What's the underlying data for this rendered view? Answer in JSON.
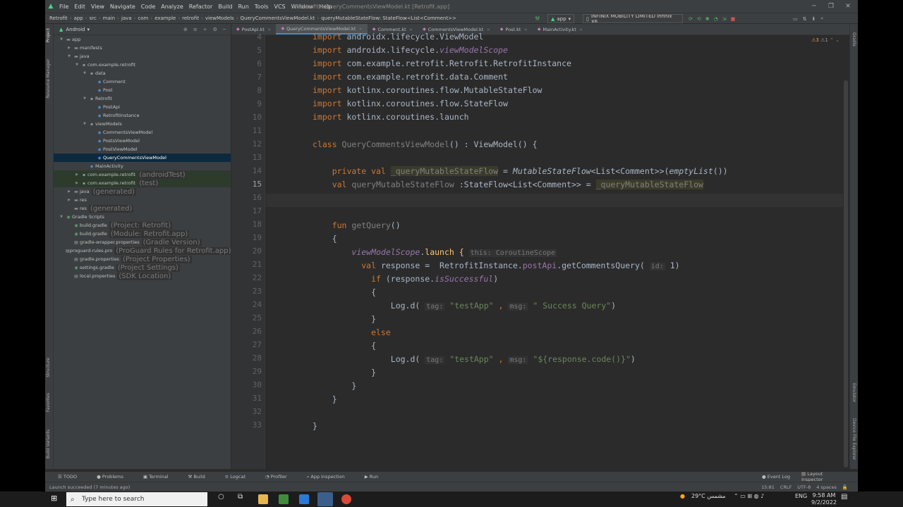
{
  "window": {
    "title": "Retrofit - QueryCommentsViewModel.kt [Retrofit.app]",
    "menu": [
      "File",
      "Edit",
      "View",
      "Navigate",
      "Code",
      "Analyze",
      "Refactor",
      "Build",
      "Run",
      "Tools",
      "VCS",
      "Window",
      "Help"
    ]
  },
  "nav": {
    "crumbs": [
      "Retrofit",
      "app",
      "src",
      "main",
      "java",
      "com",
      "example",
      "retrofit",
      "viewModels",
      "QueryCommentsViewModel.kt",
      "queryMutableStateFlow: StateFlow<List<Comment>>"
    ],
    "run_config": "app",
    "device": "INFINIX MOBILITY LIMITED Infinix X6..."
  },
  "project": {
    "view": "Android",
    "tree": [
      {
        "label": "app",
        "hint": "",
        "depth": 0,
        "icon": "folder-icon",
        "open": true
      },
      {
        "label": "manifests",
        "hint": "",
        "depth": 1,
        "icon": "folder-icon",
        "open": false
      },
      {
        "label": "java",
        "hint": "",
        "depth": 1,
        "icon": "folder-icon",
        "open": true
      },
      {
        "label": "com.example.retrofit",
        "hint": "",
        "depth": 2,
        "icon": "package-icon",
        "open": true
      },
      {
        "label": "data",
        "hint": "",
        "depth": 3,
        "icon": "package-icon",
        "open": true
      },
      {
        "label": "Comment",
        "hint": "",
        "depth": 4,
        "icon": "kotlin-class-icon",
        "open": null
      },
      {
        "label": "Post",
        "hint": "",
        "depth": 4,
        "icon": "kotlin-class-icon",
        "open": null
      },
      {
        "label": "Retrofit",
        "hint": "",
        "depth": 3,
        "icon": "package-icon",
        "open": true
      },
      {
        "label": "PostApi",
        "hint": "",
        "depth": 4,
        "icon": "kotlin-class-icon",
        "open": null
      },
      {
        "label": "RetrofitInstance",
        "hint": "",
        "depth": 4,
        "icon": "kotlin-class-icon",
        "open": null
      },
      {
        "label": "viewModels",
        "hint": "",
        "depth": 3,
        "icon": "package-icon",
        "open": true
      },
      {
        "label": "CommentsViewModel",
        "hint": "",
        "depth": 4,
        "icon": "kotlin-class-icon",
        "open": null
      },
      {
        "label": "PostsViewModel",
        "hint": "",
        "depth": 4,
        "icon": "kotlin-class-icon",
        "open": null
      },
      {
        "label": "PostViewModel",
        "hint": "",
        "depth": 4,
        "icon": "kotlin-class-icon",
        "open": null
      },
      {
        "label": "QueryCommentsViewModel",
        "hint": "",
        "depth": 4,
        "icon": "kotlin-class-icon",
        "open": null,
        "selected": true
      },
      {
        "label": "MainActivity",
        "hint": "",
        "depth": 3,
        "icon": "kotlin-class-icon",
        "open": null
      },
      {
        "label": "com.example.retrofit",
        "hint": "(androidTest)",
        "depth": 2,
        "icon": "package-icon",
        "open": false,
        "test": true
      },
      {
        "label": "com.example.retrofit",
        "hint": "(test)",
        "depth": 2,
        "icon": "package-icon",
        "open": false,
        "test": true
      },
      {
        "label": "java",
        "hint": "(generated)",
        "depth": 1,
        "icon": "folder-icon",
        "open": false
      },
      {
        "label": "res",
        "hint": "",
        "depth": 1,
        "icon": "folder-icon",
        "open": false
      },
      {
        "label": "res",
        "hint": "(generated)",
        "depth": 1,
        "icon": "folder-icon",
        "open": null
      },
      {
        "label": "Gradle Scripts",
        "hint": "",
        "depth": 0,
        "icon": "gradle-icon",
        "open": true
      },
      {
        "label": "build.gradle",
        "hint": "(Project: Retrofit)",
        "depth": 1,
        "icon": "gradle-icon",
        "open": null
      },
      {
        "label": "build.gradle",
        "hint": "(Module: Retrofit.app)",
        "depth": 1,
        "icon": "gradle-icon",
        "open": null
      },
      {
        "label": "gradle-wrapper.properties",
        "hint": "(Gradle Version)",
        "depth": 1,
        "icon": "properties-icon",
        "open": null
      },
      {
        "label": "proguard-rules.pro",
        "hint": "(ProGuard Rules for Retrofit.app)",
        "depth": 1,
        "icon": "properties-icon",
        "open": null
      },
      {
        "label": "gradle.properties",
        "hint": "(Project Properties)",
        "depth": 1,
        "icon": "properties-icon",
        "open": null
      },
      {
        "label": "settings.gradle",
        "hint": "(Project Settings)",
        "depth": 1,
        "icon": "gradle-icon",
        "open": null
      },
      {
        "label": "local.properties",
        "hint": "(SDK Location)",
        "depth": 1,
        "icon": "properties-icon",
        "open": null
      }
    ]
  },
  "tabs": [
    {
      "label": "PostApi.kt",
      "active": false
    },
    {
      "label": "QueryCommentsViewModel.kt",
      "active": true
    },
    {
      "label": "Comment.kt",
      "active": false
    },
    {
      "label": "CommentsViewModel.kt",
      "active": false
    },
    {
      "label": "Post.kt",
      "active": false
    },
    {
      "label": "MainActivity.kt",
      "active": false
    }
  ],
  "inspections": {
    "warnings": "3",
    "weak": "1"
  },
  "line_numbers": [
    "4",
    "5",
    "6",
    "7",
    "8",
    "9",
    "10",
    "11",
    "12",
    "13",
    "14",
    "15",
    "16",
    "17",
    "18",
    "19",
    "20",
    "21",
    "22",
    "23",
    "24",
    "25",
    "26",
    "27",
    "28",
    "29",
    "30",
    "31",
    "32",
    "33"
  ],
  "code": {
    "l4a": "import",
    "l4b": " androidx.lifecycle.ViewModel",
    "l5a": "import",
    "l5b": " androidx.lifecycle.",
    "l5c": "viewModelScope",
    "l6a": "import",
    "l6b": " com.example.retrofit.Retrofit.RetrofitInstance",
    "l7a": "import",
    "l7b": " com.example.retrofit.data.Comment",
    "l8a": "import",
    "l8b": " kotlinx.coroutines.flow.MutableStateFlow",
    "l9a": "import",
    "l9b": " kotlinx.coroutines.flow.StateFlow",
    "l10a": "import",
    "l10b": " kotlinx.coroutines.launch",
    "l12a": "class",
    "l12b": " QueryCommentsViewModel",
    "l12c": "() : ViewModel() {",
    "l14a": "    private val ",
    "l14b": "_queryMutableStateFlow",
    "l14c": " = ",
    "l14d": "MutableStateFlow",
    "l14e": "<List<Comment>>(",
    "l14f": "emptyList",
    "l14g": "())",
    "l15a": "    val ",
    "l15b": "queryMutableStateFlow",
    "l15c": " :StateFlow<List<Comment>> = ",
    "l15d": "_queryMutableStateFlow",
    "l18a": "    fun ",
    "l18b": "getQuery",
    "l18c": "()",
    "l19a": "    {",
    "l20a": "        viewModelScope",
    "l20b": ".",
    "l20c": "launch",
    "l20d": " { ",
    "l20e": "this: CoroutineScope",
    "l21a": "          val ",
    "l21b": "response =  RetrofitInstance.",
    "l21c": "postApi",
    "l21d": ".getCommentsQuery( ",
    "l21e": "id:",
    "l21f": " 1)",
    "l22a": "            if ",
    "l22b": "(response.",
    "l22c": "isSuccessful",
    ")": ")",
    "l22d": ")",
    "l23a": "            {",
    "l24a": "                Log.d( ",
    "l24b": "tag:",
    "l24c": " \"testApp\"",
    "l24d": " , ",
    "l24e": "msg:",
    "l24f": " \" Success Query\"",
    "l24g": ")",
    "l25a": "            }",
    "l26a": "            else",
    "l27a": "            {",
    "l28a": "                Log.d( ",
    "l28b": "tag:",
    "l28c": " \"testApp\"",
    "l28d": " , ",
    "l28e": "msg:",
    "l28f": " \"${response.code()}\"",
    "l28g": ")",
    "l29a": "            }",
    "l30a": "        }",
    "l31a": "    }",
    "l33a": "}"
  },
  "bottom_tools": [
    "TODO",
    "Problems",
    "Terminal",
    "Build",
    "Logcat",
    "Profiler",
    "App Inspection",
    "Run"
  ],
  "bottom_right": [
    "Event Log",
    "Layout Inspector"
  ],
  "status": {
    "message": "Launch succeeded (7 minutes ago)",
    "position": "15:81",
    "line_sep": "CRLF",
    "encoding": "UTF-8",
    "indent": "4 spaces"
  },
  "left_tools": [
    "Project",
    "Resource Manager",
    "Structure",
    "Favorites",
    "Build Variants"
  ],
  "right_tools": [
    "Gradle",
    "Emulator",
    "Device File Explorer"
  ],
  "taskbar": {
    "search_placeholder": "Type here to search",
    "weather": "29°C مشمس",
    "lang": "ENG",
    "time": "9:58 AM",
    "date": "9/2/2022"
  }
}
